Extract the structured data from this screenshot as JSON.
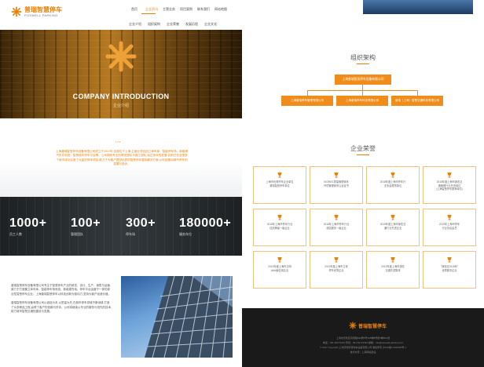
{
  "brand": {
    "name_cn": "普瑞智慧停车",
    "name_en": "POSWELL PARKING",
    "accent": "#e8820c"
  },
  "nav": {
    "items": [
      "首页",
      "企业资讯",
      "主营业务",
      "项目案例",
      "联系我们",
      "网站地图"
    ],
    "active_index": 1
  },
  "subnav": {
    "items": [
      "企业介绍",
      "组织架构",
      "企业荣誉",
      "发展历程",
      "企业文化"
    ]
  },
  "hero": {
    "title": "COMPANY INTRODUCTION",
    "subtitle": "企业介绍"
  },
  "intro": {
    "dots": "•••",
    "text": "上海普瑞智慧停车设备有限公司成立于2017年,总部位于上海,主营业务包括立体车库、智能停车场、新能源汽车充电桩、智慧城市停车平台等。公司拥有专业的研发团队与施工团队,经过多年的发展,目前已在全国多个城市成功实施了大量的停车项目,致力于为客户提供优质的智慧停车整体解决方案,以科技推动城市停车的发展与进步。"
  },
  "stats": [
    {
      "num": "1000+",
      "label": "员工人数"
    },
    {
      "num": "100+",
      "label": "管理团队"
    },
    {
      "num": "300+",
      "label": "停车场"
    },
    {
      "num": "180000+",
      "label": "服务车位"
    }
  ],
  "about": {
    "para1": "普瑞智慧停车设备有限公司专注于智慧停车产业的研发、设计、生产、销售与运营,致力于打造集立体车库、智能停车场系统、新能源充电、停车平台运营于一体的综合性智慧停车企业。上海普瑞智慧停车以科技创新为驱动力,坚持为客户创造价值。",
    "para2": "普瑞智慧停车设备有限公司以诚信为本,以质量为先,在城市停车领域不断深耕,打造了众多精品工程,赢得了客户的信赖与好评。公司将继续以专业的服务与领先的技术,助力城市智慧交通的建设与发展。"
  },
  "org": {
    "title": "组织架构",
    "root": "上海普瑞智慧停车设备有限公司",
    "children": [
      "上海普瑞停车管理有限公司",
      "上海普瑞停车科技有限公司",
      "普瑞（上海）智慧交通科技有限公司"
    ]
  },
  "honors": {
    "title": "企业荣誉",
    "items": [
      "上海市优秀停车企业单位\n普瑞智慧停车单位",
      "ISO9001质量管理体系\n环境管理体系认证证书",
      "2018年度上海市停车行\n业协会理事单位",
      "2018年度上海市静态交\n通管理行业先进单位\n（上海智慧停车推荐单位）",
      "2018年上海市停车行业\n信用等级一级企业",
      "2018年上海市停车行业\n诚信服务一级企业",
      "2019年度上海市静态交\n通行业先进企业",
      "2019年上海市停车\n行业协会会员",
      "2019年度上海市文明\nAAA级信用企业",
      "2019年度上海市立体\n停车优秀企业",
      "2019年度上海市静态\n交通先进集体",
      "\"静安区2018年\"\n优秀服务企业"
    ]
  },
  "footer": {
    "line1": "上海市普陀区真南路822弄8号228幢8号楼1幢8F2层",
    "line2": "电话：021-52173315  传真：021-52173315  邮箱：info@poswell-parking.com",
    "line3": "© 2017 Copyright 上海普瑞智慧停车设备有限公司 版权所有 沪ICP备17000000号-1",
    "line4": "技术支持：上海网站建设"
  }
}
